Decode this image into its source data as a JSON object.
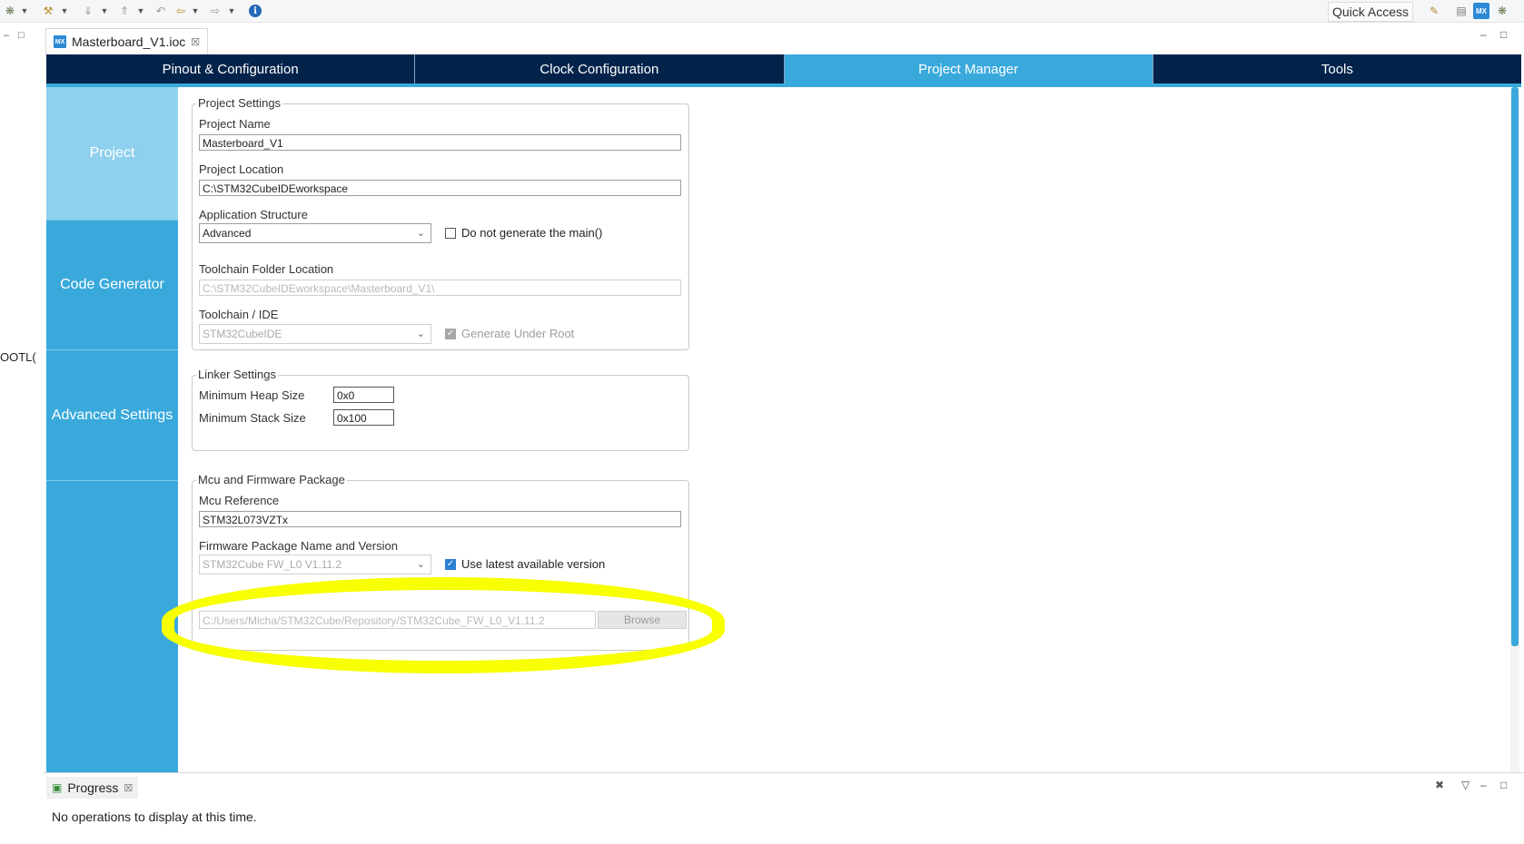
{
  "toolbar": {
    "quick_access": "Quick Access",
    "info_glyph": "i",
    "mx_label": "MX"
  },
  "left_strip": {
    "clipped_text": "OOTL("
  },
  "editor": {
    "tab_title": "Masterboard_V1.ioc",
    "tab_icon": "MX",
    "close_glyph": "☒"
  },
  "main_tabs": [
    {
      "label": "Pinout & Configuration",
      "active": false
    },
    {
      "label": "Clock Configuration",
      "active": false
    },
    {
      "label": "Project Manager",
      "active": true
    },
    {
      "label": "Tools",
      "active": false
    }
  ],
  "sidenav": [
    {
      "label": "Project",
      "active": true
    },
    {
      "label": "Code Generator",
      "active": false
    },
    {
      "label": "Advanced Settings",
      "active": false
    }
  ],
  "project_settings": {
    "legend": "Project Settings",
    "project_name_label": "Project Name",
    "project_name_value": "Masterboard_V1",
    "project_location_label": "Project Location",
    "project_location_value": "C:\\STM32CubeIDEworkspace",
    "app_structure_label": "Application Structure",
    "app_structure_value": "Advanced",
    "no_main_label": "Do not generate the main()",
    "no_main_checked": false,
    "toolchain_folder_label": "Toolchain Folder Location",
    "toolchain_folder_value": "C:\\STM32CubeIDEworkspace\\Masterboard_V1\\",
    "toolchain_ide_label": "Toolchain / IDE",
    "toolchain_ide_value": "STM32CubeIDE",
    "gen_under_root_label": "Generate Under Root",
    "gen_under_root_checked": true
  },
  "linker_settings": {
    "legend": "Linker Settings",
    "heap_label": "Minimum Heap Size",
    "heap_value": "0x0",
    "stack_label": "Minimum Stack Size",
    "stack_value": "0x100"
  },
  "mcu_firmware": {
    "legend": "Mcu and Firmware Package",
    "mcu_ref_label": "Mcu Reference",
    "mcu_ref_value": "STM32L073VZTx",
    "fw_pkg_label": "Firmware Package Name and Version",
    "fw_pkg_value": "STM32Cube FW_L0 V1.11.2",
    "use_latest_label": "Use latest available version",
    "use_latest_checked": true,
    "repo_path_value": "C:/Users/Micha/STM32Cube/Repository/STM32Cube_FW_L0_V1.11.2",
    "browse_label": "Browse"
  },
  "progress_panel": {
    "tab_label": "Progress",
    "message": "No operations to display at this time."
  },
  "colors": {
    "nav_dark": "#03234b",
    "accent": "#39a9dc",
    "nav_active": "#8ed0ee",
    "highlight": "#f7ff00"
  }
}
